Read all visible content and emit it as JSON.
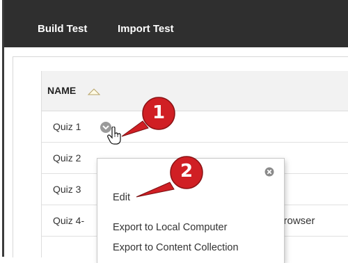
{
  "toolbar": {
    "build_test": "Build Test",
    "import_test": "Import Test"
  },
  "table": {
    "column_header": "NAME",
    "rows": [
      {
        "name": "Quiz 1"
      },
      {
        "name": "Quiz 2"
      },
      {
        "name": "Quiz 3"
      },
      {
        "name": "Quiz 4-",
        "trailing_text": "n Browser"
      }
    ]
  },
  "context_menu": {
    "items": [
      "Edit",
      "Export to Local Computer",
      "Export to Content Collection"
    ]
  },
  "callouts": [
    "1",
    "2"
  ],
  "colors": {
    "toolbar_bg": "#2f2f2f",
    "callout_red": "#d01f24",
    "header_bg": "#f2f2f2"
  },
  "icons": {
    "sort": "sort-ascending-triangle-icon",
    "options": "chevron-down-circle-icon",
    "cursor": "hand-pointer-cursor-icon",
    "close": "close-circle-icon"
  }
}
